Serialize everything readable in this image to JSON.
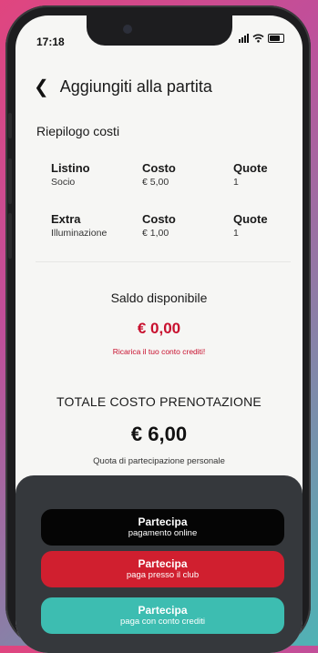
{
  "status_bar": {
    "time": "17:18"
  },
  "header": {
    "title": "Aggiungiti alla partita"
  },
  "summary": {
    "title": "Riepilogo costi",
    "rows": [
      {
        "col1_header": "Listino",
        "col1_value": "Socio",
        "col2_header": "Costo",
        "col2_value": "€ 5,00",
        "col3_header": "Quote",
        "col3_value": "1"
      },
      {
        "col1_header": "Extra",
        "col1_value": "Illuminazione",
        "col2_header": "Costo",
        "col2_value": "€ 1,00",
        "col3_header": "Quote",
        "col3_value": "1"
      }
    ]
  },
  "balance": {
    "label": "Saldo disponibile",
    "value": "€ 0,00",
    "recharge_link": "Ricarica il tuo conto crediti!"
  },
  "total": {
    "label": "TOTALE COSTO PRENOTAZIONE",
    "value": "€ 6,00",
    "note": "Quota di partecipazione personale"
  },
  "actions": {
    "online": {
      "title": "Partecipa",
      "subtitle": "pagamento online"
    },
    "club": {
      "title": "Partecipa",
      "subtitle": "paga presso il club"
    },
    "credit": {
      "title": "Partecipa",
      "subtitle": "paga con conto crediti"
    }
  },
  "colors": {
    "accent_red": "#c8102e",
    "teal": "#3dbdb1",
    "sheet": "#35383c"
  }
}
